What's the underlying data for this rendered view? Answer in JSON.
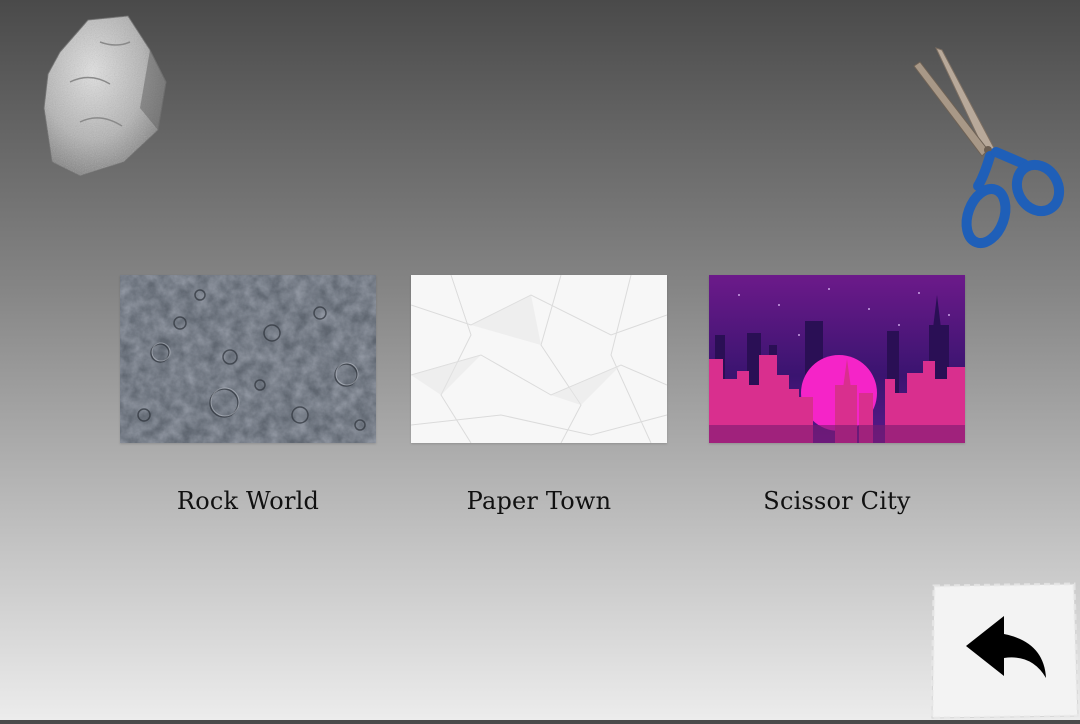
{
  "worlds": [
    {
      "id": "rock",
      "label": "Rock World"
    },
    {
      "id": "paper",
      "label": "Paper Town"
    },
    {
      "id": "scissor",
      "label": "Scissor City"
    }
  ],
  "decorations": {
    "top_left": "rock-icon",
    "top_right": "scissors-icon"
  },
  "back_button": {
    "icon": "back-arrow-icon"
  },
  "colors": {
    "background_top": "#4a4a4a",
    "background_bottom": "#ececec",
    "scissor_handle": "#1f5fb8",
    "city_pink": "#e0329a",
    "city_purple": "#5a1a8a"
  }
}
